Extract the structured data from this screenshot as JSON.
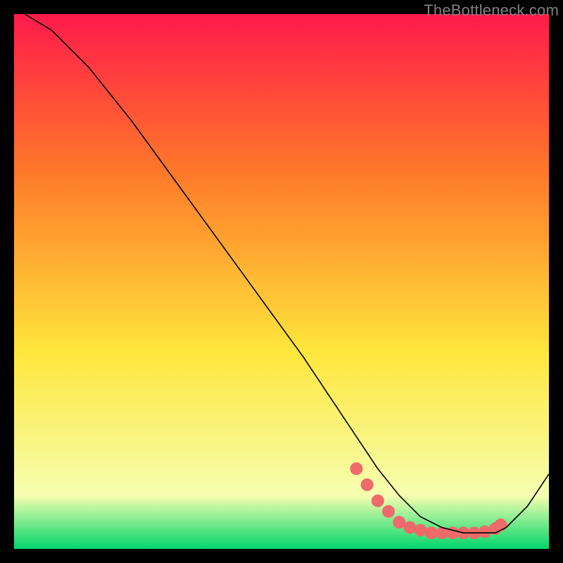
{
  "watermark": "TheBottleneck.com",
  "chart_data": {
    "type": "line",
    "title": "",
    "xlabel": "",
    "ylabel": "",
    "xlim": [
      0,
      100
    ],
    "ylim": [
      0,
      100
    ],
    "grid": false,
    "background_gradient": {
      "top": "#ff1a4b",
      "mid": "#ffe63b",
      "bottom": "#00d66b"
    },
    "series": [
      {
        "name": "curve",
        "x": [
          2,
          7,
          14,
          22,
          30,
          38,
          46,
          54,
          60,
          64,
          68,
          72,
          76,
          80,
          84,
          88,
          90,
          92,
          96,
          100
        ],
        "y": [
          100,
          97,
          90,
          80,
          69,
          58,
          47,
          36,
          27,
          21,
          15,
          10,
          6,
          4,
          3,
          3,
          3,
          4,
          8,
          14
        ],
        "color": "#000000",
        "linewidth": 1.6
      }
    ],
    "markers": {
      "name": "trough-dots",
      "x": [
        64,
        66,
        68,
        70,
        72,
        74,
        76,
        78,
        80,
        82,
        84,
        86,
        88,
        90,
        91
      ],
      "y": [
        15,
        12,
        9,
        7,
        5,
        4,
        3.5,
        3,
        3,
        3,
        3,
        3,
        3.2,
        3.8,
        4.5
      ],
      "color": "#ef6a6a",
      "size": 9
    }
  }
}
